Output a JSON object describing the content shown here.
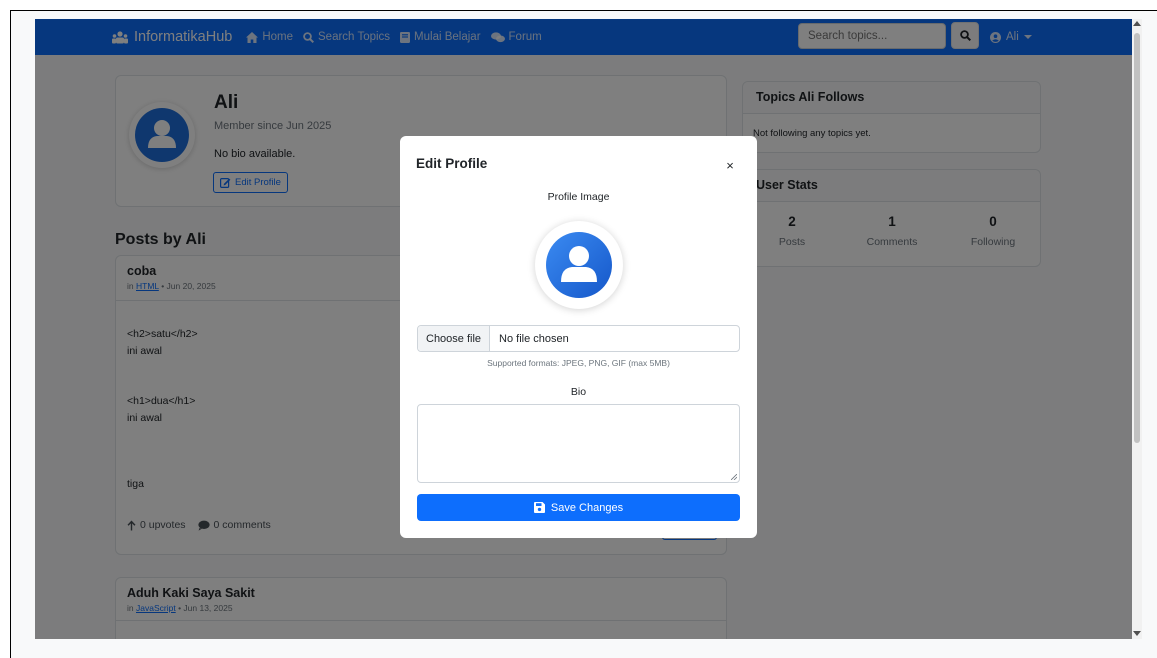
{
  "navbar": {
    "brand": "InformatikaHub",
    "links": [
      "Home",
      "Search Topics",
      "Mulai Belajar",
      "Forum"
    ],
    "search_placeholder": "Search topics...",
    "user": "Ali",
    "color": "#0d6efd"
  },
  "profile": {
    "name": "Ali",
    "member_since": "Member since Jun 2025",
    "bio": "No bio available.",
    "edit_label": "Edit Profile"
  },
  "posts": {
    "heading": "Posts by Ali",
    "items": [
      {
        "title": "coba",
        "meta_prefix": "in",
        "topic": "HTML",
        "date": "• Jun 20, 2025",
        "lines": [
          "<h2>satu</h2>",
          "ini awal",
          "<h1>dua</h1>",
          "ini awal",
          "tiga"
        ],
        "upvotes": "0 upvotes",
        "comments": "0 comments"
      },
      {
        "title": "Aduh Kaki Saya Sakit",
        "meta_prefix": "in",
        "topic": "JavaScript",
        "date": "• Jun 13, 2025"
      }
    ]
  },
  "follows": {
    "title": "Topics Ali Follows",
    "empty": "Not following any topics yet."
  },
  "stats": {
    "title": "User Stats",
    "items": [
      {
        "value": "2",
        "label": "Posts"
      },
      {
        "value": "1",
        "label": "Comments"
      },
      {
        "value": "0",
        "label": "Following"
      }
    ]
  },
  "modal": {
    "title": "Edit Profile",
    "close": "×",
    "image_label": "Profile Image",
    "choose_file": "Choose file",
    "file_status": "No file chosen",
    "help": "Supported formats: JPEG, PNG, GIF (max 5MB)",
    "bio_label": "Bio",
    "save_label": "Save Changes"
  }
}
